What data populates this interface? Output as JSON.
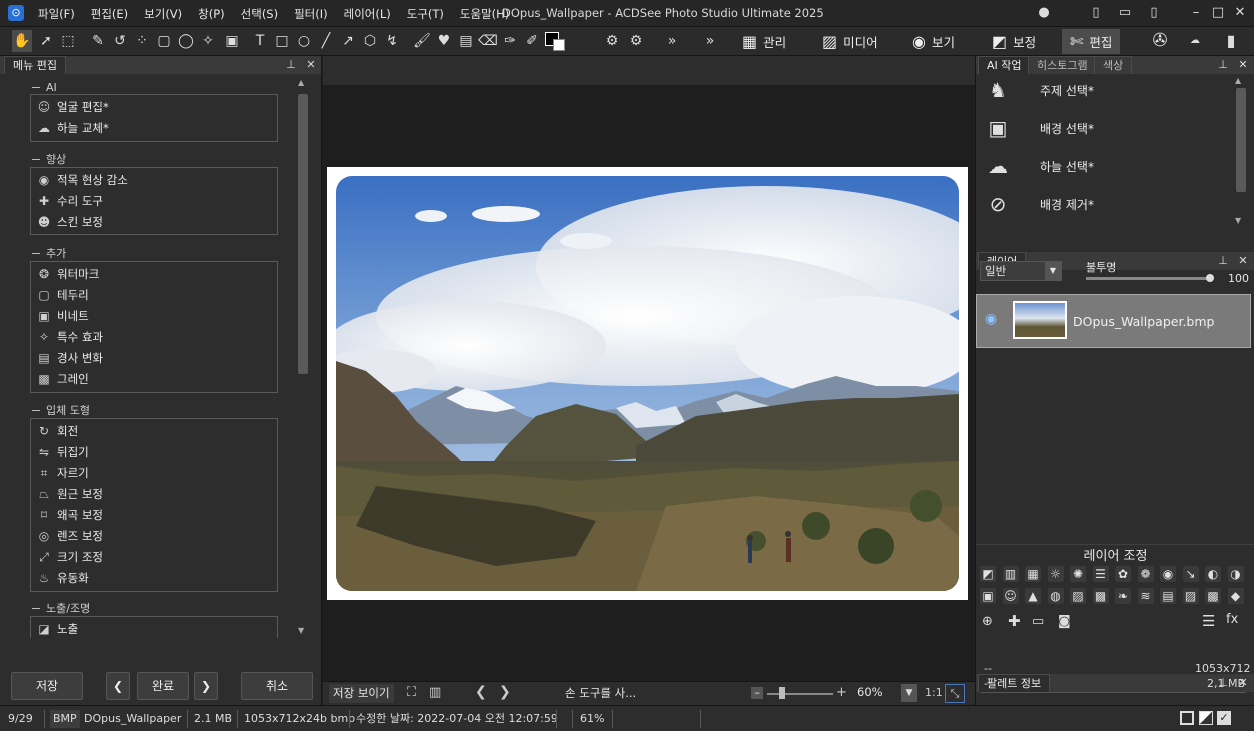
{
  "app": {
    "title": "DOpus_Wallpaper - ACDSee Photo Studio Ultimate 2025",
    "menu": [
      "파일(F)",
      "편집(E)",
      "보기(V)",
      "창(P)",
      "선택(S)",
      "필터(I)",
      "레이어(L)",
      "도구(T)",
      "도움말(H)"
    ]
  },
  "modes": [
    {
      "label": "관리",
      "icon": "grid-icon"
    },
    {
      "label": "미디어",
      "icon": "media-icon"
    },
    {
      "label": "보기",
      "icon": "eye-icon"
    },
    {
      "label": "보정",
      "icon": "develop-icon"
    },
    {
      "label": "편집",
      "icon": "edit-icon",
      "active": true
    }
  ],
  "left_panel": {
    "tab": "메뉴 편집",
    "groups": [
      {
        "title": "AI",
        "items": [
          "얼굴 편집*",
          "하늘 교체*"
        ]
      },
      {
        "title": "향상",
        "items": [
          "적목 현상 감소",
          "수리 도구",
          "스킨 보정"
        ]
      },
      {
        "title": "추가",
        "items": [
          "워터마크",
          "테두리",
          "비네트",
          "특수 효과",
          "경사 변화",
          "그레인"
        ]
      },
      {
        "title": "입체 도형",
        "items": [
          "회전",
          "뒤집기",
          "자르기",
          "원근 보정",
          "왜곡 보정",
          "렌즈 보정",
          "크기 조정",
          "유동화"
        ]
      },
      {
        "title": "노출/조명",
        "items": [
          "노출"
        ]
      }
    ],
    "footer": {
      "save": "저장",
      "done": "완료",
      "cancel": "취소"
    }
  },
  "center": {
    "bottom": {
      "save_view": "저장 보이기",
      "hint": "손 도구를 사...",
      "zoom": "60%",
      "ratio": "1:1"
    }
  },
  "right_panel": {
    "ai_tabs": [
      "AI 작업",
      "히스토그램",
      "색상"
    ],
    "ai_items": [
      "주제 선택*",
      "배경 선택*",
      "하늘 선택*",
      "배경 제거*"
    ],
    "layers": {
      "tab": "레이어",
      "blend_mode": "일반",
      "opacity_label": "불투명",
      "opacity_value": "100",
      "opacity": 1.0,
      "layer_name": "DOpus_Wallpaper.bmp",
      "adjust_title": "레이어 조정"
    },
    "palette": {
      "tab": "팔레트 정보",
      "rows": [
        {
          "left": "--",
          "right": "1053x712"
        },
        {
          "left": "--",
          "right": "2,1 MB"
        }
      ]
    }
  },
  "status": {
    "index": "9/29",
    "type": "BMP",
    "filename": "DOpus_Wallpaper",
    "size": "2.1 MB",
    "dims": "1053x712x24b bmp",
    "modified": "수정한 날짜: 2022-07-04 오전 12:07:59",
    "zoom": "61%"
  },
  "colors": {
    "accent": "#2a6fd6",
    "active_mode": "#4c4c4c",
    "panel": "#2d2d2d"
  }
}
